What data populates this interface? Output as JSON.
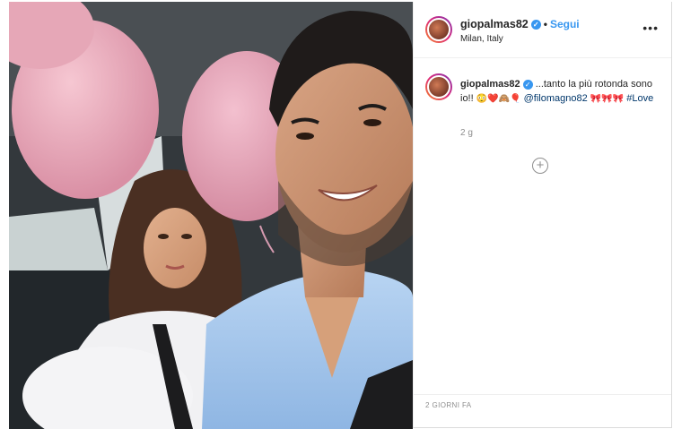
{
  "header": {
    "username": "giopalmas82",
    "separator": "•",
    "follow_label": "Segui",
    "location": "Milan, Italy",
    "more_icon": "more-horizontal-icon"
  },
  "caption": {
    "username": "giopalmas82",
    "text_1": "...tanto la più rotonda sono io!!",
    "emoji_1": "😳❤️🙈🎈",
    "mention": "@filomagno82",
    "emoji_2": "🎀🎀🎀",
    "hashtag": "#Love"
  },
  "timestamp_short": "2 g",
  "timestamp_long": "2 GIORNI FA",
  "colors": {
    "link_blue": "#3897f0",
    "text": "#262626",
    "muted": "#8e8e8e"
  }
}
